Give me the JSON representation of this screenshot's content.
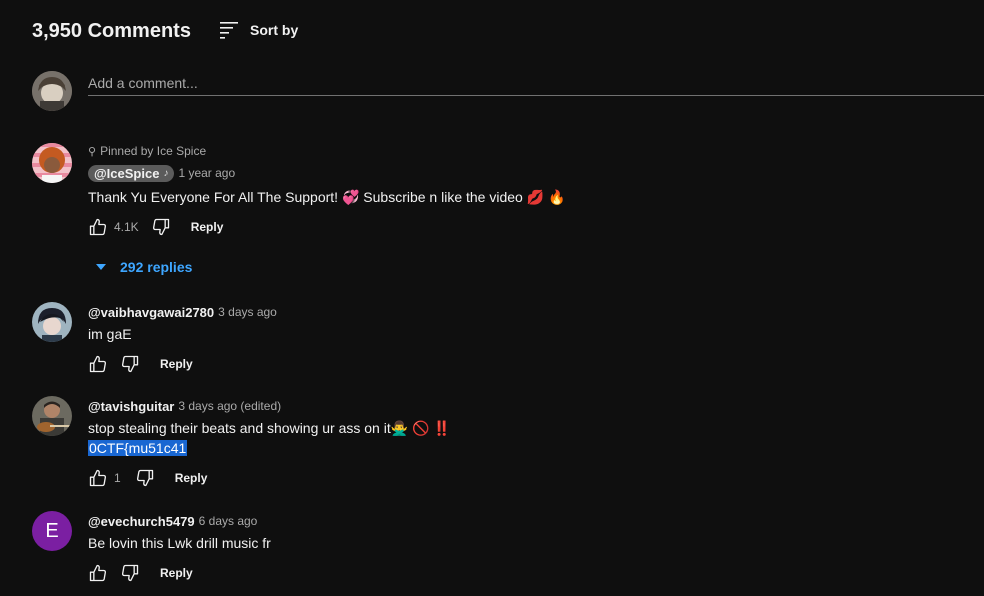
{
  "header": {
    "count": "3,950 Comments",
    "sort_label": "Sort by"
  },
  "add_comment": {
    "placeholder": "Add a comment..."
  },
  "comments": [
    {
      "pinned_label": "Pinned by Ice Spice",
      "author": "@IceSpice",
      "time": "1 year ago",
      "text": "Thank Yu Everyone For All The Support! 💞 Subscribe n like the video 💋 🔥",
      "likes": "4.1K",
      "reply_label": "Reply",
      "replies_label": "292 replies"
    },
    {
      "author": "@vaibhavgawai2780",
      "time": "3 days ago",
      "text": "im gaE",
      "likes": "",
      "reply_label": "Reply"
    },
    {
      "author": "@tavishguitar",
      "time": "3 days ago (edited)",
      "text": "stop stealing their beats and showing ur ass on it🙅‍♂️ 🚫 ‼️",
      "text_line2": "0CTF{mu51c41",
      "likes": "1",
      "reply_label": "Reply"
    },
    {
      "author": "@evechurch5479",
      "time": "6 days ago",
      "avatar_letter": "E",
      "text": "Be lovin this Lwk drill music fr",
      "likes": "",
      "reply_label": "Reply"
    }
  ],
  "colors": {
    "background": "#0f0f0f",
    "link": "#3ea6ff",
    "highlight": "#1967d2",
    "letter_avatar": "#7b1fa2"
  },
  "icons": [
    "sort-icon",
    "pin-icon",
    "music-note-icon",
    "thumbs-up-icon",
    "thumbs-down-icon",
    "caret-down-icon"
  ]
}
